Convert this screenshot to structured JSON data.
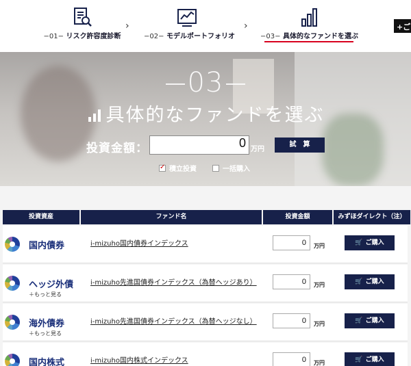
{
  "steps": [
    {
      "num": "−01−",
      "label": "リスク許容度診断",
      "icon": "document-search-icon"
    },
    {
      "num": "−02−",
      "label": "モデルポートフォリオ",
      "icon": "portfolio-chart-icon"
    },
    {
      "num": "−03−",
      "label": "具体的なファンドを選ぶ",
      "icon": "bar-chart-icon"
    }
  ],
  "corner_button": "+ご",
  "hero": {
    "step_number": "03",
    "title": "具体的なファンドを選ぶ",
    "amount_label": "投資金額：",
    "amount_value": "0",
    "amount_unit": "万円",
    "calc_button": "試　算",
    "check_periodic": "積立投資",
    "check_periodic_checked": true,
    "check_lump": "一括購入",
    "check_lump_checked": false
  },
  "table": {
    "headers": [
      "投資資産",
      "ファンド名",
      "投資金額",
      "みずほダイレクト（注）"
    ],
    "rows": [
      {
        "asset": "国内債券",
        "more": "",
        "fund": "i-mizuho国内債券インデックス",
        "value": "0",
        "unit": "万円",
        "buy": "ご購入"
      },
      {
        "asset": "ヘッジ外債",
        "more": "＋もっと見る",
        "fund": "i-mizuho先進国債券インデックス（為替ヘッジあり）",
        "value": "0",
        "unit": "万円",
        "buy": "ご購入"
      },
      {
        "asset": "海外債券",
        "more": "＋もっと見る",
        "fund": "i-mizuho先進国債券インデックス（為替ヘッジなし）",
        "value": "0",
        "unit": "万円",
        "buy": "ご購入"
      },
      {
        "asset": "国内株式",
        "more": "",
        "fund": "i-mizuho国内株式インデックス",
        "value": "0",
        "unit": "万円",
        "buy": "ご購入"
      }
    ]
  },
  "colors": {
    "navy": "#17214a",
    "accent_red": "#d8001e",
    "asset_blue": "#1a2f7a"
  }
}
